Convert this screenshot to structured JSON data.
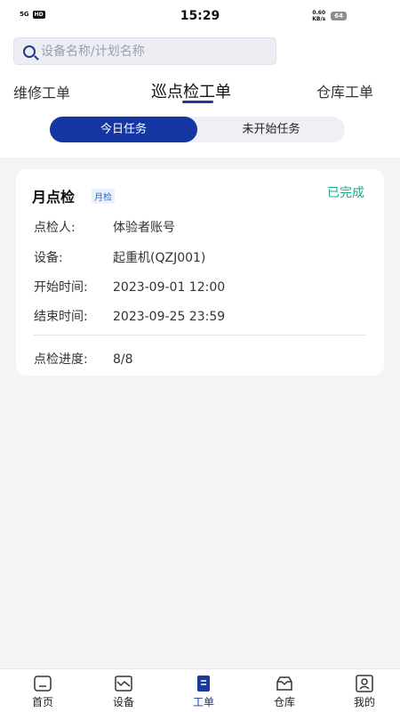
{
  "status_bar": {
    "signal": "5G",
    "hd": "HD",
    "time": "15:29",
    "speed_value": "0.60",
    "speed_unit": "KB/s",
    "battery": "64"
  },
  "search": {
    "placeholder": "设备名称/计划名称"
  },
  "tabs": [
    {
      "label": "维修工单",
      "active": false
    },
    {
      "label": "巡点检工单",
      "active": true
    },
    {
      "label": "仓库工单",
      "active": false
    }
  ],
  "segment": {
    "today": "今日任务",
    "not_started": "未开始任务"
  },
  "card": {
    "title": "月点检",
    "tag": "月检",
    "status": "已完成",
    "status_color": "#23a58a",
    "fields": [
      {
        "label": "点检人:",
        "value": "体验者账号"
      },
      {
        "label": "设备:",
        "value": "起重机(QZJ001)"
      },
      {
        "label": "开始时间:",
        "value": "2023-09-01 12:00"
      },
      {
        "label": "结束时间:",
        "value": "2023-09-25 23:59"
      }
    ],
    "progress_label": "点检进度:",
    "progress_value": "8/8"
  },
  "bottom_nav": [
    {
      "label": "首页",
      "icon": "home-icon",
      "active": false
    },
    {
      "label": "设备",
      "icon": "device-icon",
      "active": false
    },
    {
      "label": "工单",
      "icon": "work-order-icon",
      "active": true
    },
    {
      "label": "仓库",
      "icon": "warehouse-icon",
      "active": false
    },
    {
      "label": "我的",
      "icon": "profile-icon",
      "active": false
    }
  ],
  "colors": {
    "accent": "#1537a3",
    "completed": "#23a58a"
  }
}
